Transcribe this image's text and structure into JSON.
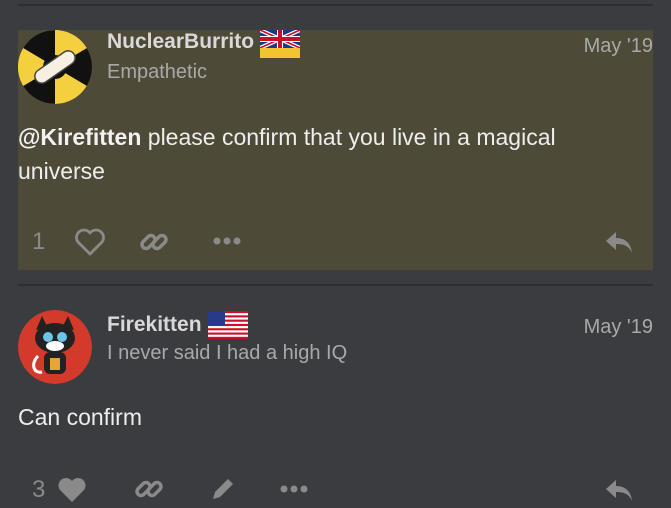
{
  "posts": [
    {
      "username": "NuclearBurrito",
      "user_title": "Empathetic",
      "date": "May '19",
      "mention": "@Kirefitten",
      "body_text": " please confirm that you live in a magical universe",
      "likes": "1",
      "flag_icon": "uk-flag-icon",
      "avatar_icon": "radiation-burrito-avatar"
    },
    {
      "username": "Firekitten",
      "user_title": "I never said I had a high IQ",
      "date": "May '19",
      "body_text": "Can confirm",
      "likes": "3",
      "flag_icon": "us-flag-icon",
      "avatar_icon": "cat-avatar"
    }
  ],
  "colors": {
    "background": "#3b3c40",
    "highlight": "#4d4a37",
    "action_icon": "#8a8a8a"
  }
}
